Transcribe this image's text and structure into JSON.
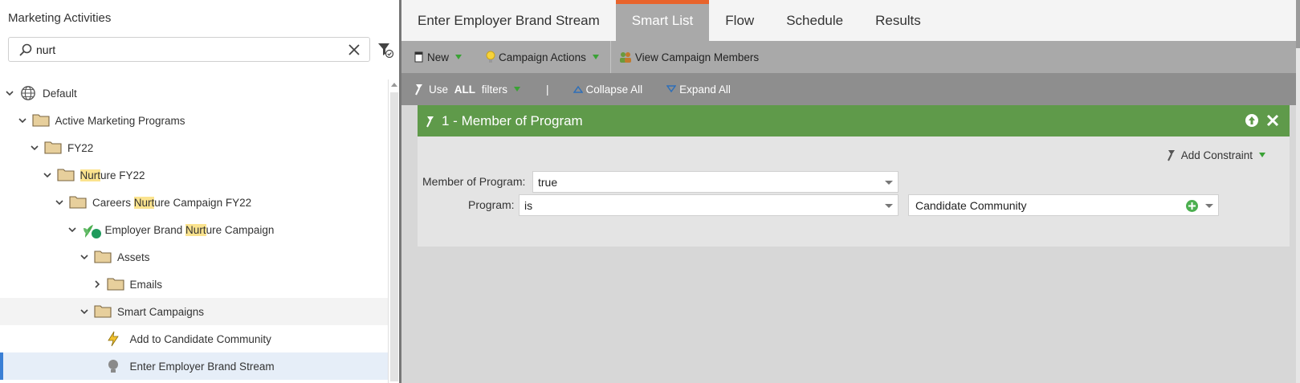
{
  "left_panel": {
    "title": "Marketing Activities",
    "search": {
      "value": "nurt",
      "placeholder": ""
    },
    "tree": [
      {
        "text_parts": [
          [
            "Default",
            false
          ]
        ],
        "icon": "globe-icon",
        "expanded": true
      },
      {
        "text_parts": [
          [
            "Active Marketing Programs",
            false
          ]
        ],
        "icon": "folder-icon",
        "expanded": true
      },
      {
        "text_parts": [
          [
            "FY22",
            false
          ]
        ],
        "icon": "folder-icon",
        "expanded": true
      },
      {
        "text_parts": [
          [
            "Nurt",
            true
          ],
          [
            "ure FY22",
            false
          ]
        ],
        "icon": "folder-icon",
        "expanded": true
      },
      {
        "text_parts": [
          [
            "Careers ",
            false
          ],
          [
            "Nurt",
            true
          ],
          [
            "ure Campaign FY22",
            false
          ]
        ],
        "icon": "folder-icon",
        "expanded": true
      },
      {
        "text_parts": [
          [
            "Employer Brand ",
            false
          ],
          [
            "Nurt",
            true
          ],
          [
            "ure Campaign",
            false
          ]
        ],
        "icon": "nurture-program-icon",
        "expanded": true
      },
      {
        "text_parts": [
          [
            "Assets",
            false
          ]
        ],
        "icon": "folder-icon",
        "expanded": true
      },
      {
        "text_parts": [
          [
            "Emails",
            false
          ]
        ],
        "icon": "folder-icon",
        "expanded": false
      },
      {
        "text_parts": [
          [
            "Smart Campaigns",
            false
          ]
        ],
        "icon": "folder-icon",
        "expanded": true
      },
      {
        "text_parts": [
          [
            "Add to Candidate Community",
            false
          ]
        ],
        "icon": "trigger-campaign-icon"
      },
      {
        "text_parts": [
          [
            "Enter Employer Brand Stream",
            false
          ]
        ],
        "icon": "batch-campaign-icon",
        "selected": true
      }
    ]
  },
  "right_panel": {
    "tabs": [
      {
        "label": "Enter Employer Brand Stream"
      },
      {
        "label": "Smart List",
        "active": true
      },
      {
        "label": "Flow"
      },
      {
        "label": "Schedule"
      },
      {
        "label": "Results"
      }
    ],
    "toolbar": {
      "new_label": "New",
      "campaign_actions_label": "Campaign Actions",
      "view_members_label": "View Campaign Members"
    },
    "filter_toolbar": {
      "use_prefix": "Use ",
      "use_bold": "ALL",
      "use_suffix": " filters",
      "separator": "|",
      "collapse_all": "Collapse All",
      "expand_all": "Expand All"
    },
    "filter": {
      "number": "1 - ",
      "name": "Member of Program",
      "add_constraint": "Add Constraint",
      "rows": [
        {
          "label": "Member of Program:",
          "value": "true"
        },
        {
          "label": "Program:",
          "operator": "is",
          "value": "Candidate Community"
        }
      ]
    }
  },
  "colors": {
    "tab_accent": "#e8632b",
    "filter_header": "#5f9a4a",
    "highlight": "#fbe38e",
    "selection_bar": "#3a7fd5"
  }
}
